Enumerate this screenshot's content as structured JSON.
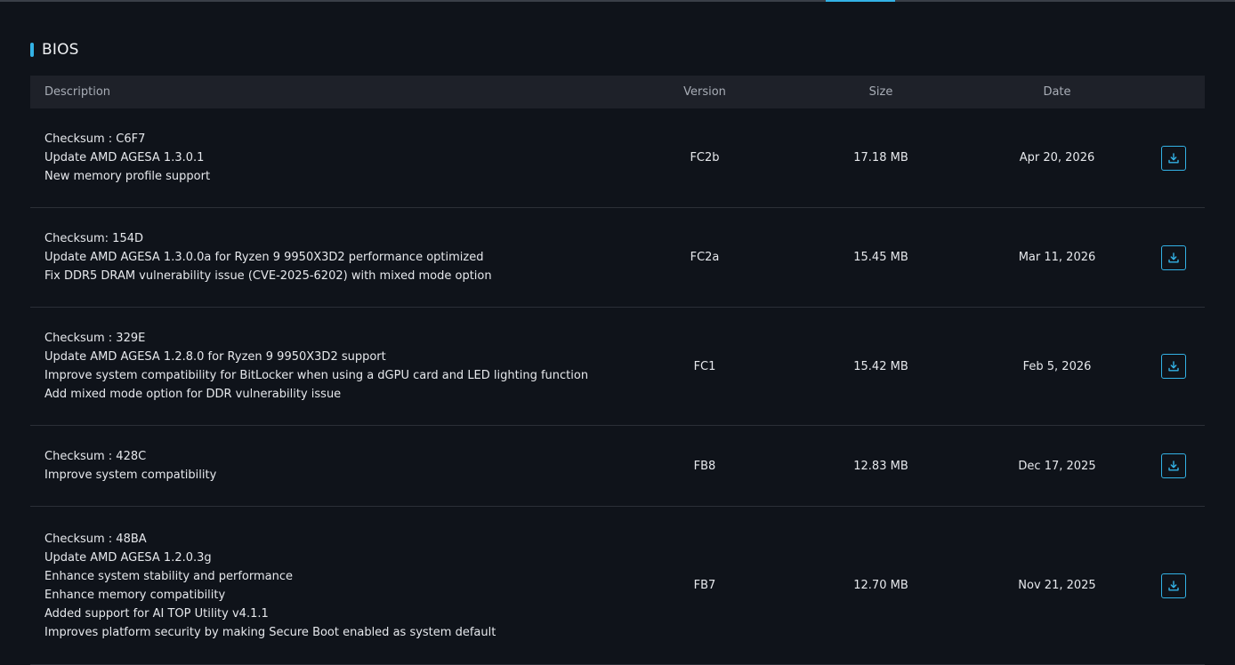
{
  "section": {
    "title": "BIOS"
  },
  "table": {
    "headers": {
      "description": "Description",
      "version": "Version",
      "size": "Size",
      "date": "Date"
    },
    "rows": [
      {
        "lines": [
          "Checksum : C6F7",
          "Update AMD AGESA 1.3.0.1",
          "New memory profile support"
        ],
        "version": "FC2b",
        "size": "17.18 MB",
        "date": "Apr 20, 2026"
      },
      {
        "lines": [
          "Checksum: 154D",
          "Update AMD AGESA 1.3.0.0a for Ryzen 9 9950X3D2 performance optimized",
          "Fix DDR5 DRAM vulnerability issue (CVE-2025-6202) with mixed mode option"
        ],
        "version": "FC2a",
        "size": "15.45 MB",
        "date": "Mar 11, 2026"
      },
      {
        "lines": [
          "Checksum : 329E",
          "Update AMD AGESA 1.2.8.0 for Ryzen 9 9950X3D2 support",
          "Improve system compatibility for BitLocker when using a dGPU card and LED lighting function",
          "Add mixed mode option for DDR vulnerability issue"
        ],
        "version": "FC1",
        "size": "15.42 MB",
        "date": "Feb 5, 2026"
      },
      {
        "lines": [
          "Checksum : 428C",
          "Improve system compatibility"
        ],
        "version": "FB8",
        "size": "12.83 MB",
        "date": "Dec 17, 2025"
      },
      {
        "lines": [
          "Checksum : 48BA",
          "Update AMD AGESA 1.2.0.3g",
          "Enhance system stability and performance",
          "Enhance memory compatibility",
          "Added support for AI TOP Utility v4.1.1",
          "Improves platform security by making Secure Boot enabled as system default"
        ],
        "version": "FB7",
        "size": "12.70 MB",
        "date": "Nov 21, 2025"
      }
    ]
  },
  "icons": {
    "download": "download-icon"
  },
  "colors": {
    "accent": "#33b2e6",
    "background": "#0f131a",
    "header_bg": "#1e2129"
  }
}
